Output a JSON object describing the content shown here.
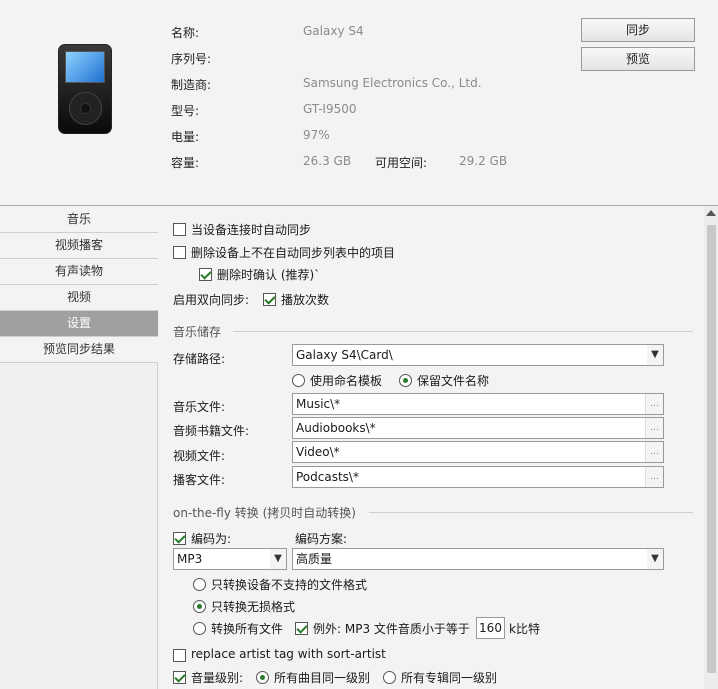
{
  "device": {
    "name_label": "名称:",
    "name_value": "Galaxy S4",
    "serial_label": "序列号:",
    "serial_value": "",
    "maker_label": "制造商:",
    "maker_value": "Samsung Electronics Co., Ltd.",
    "model_label": "型号:",
    "model_value": "GT-I9500",
    "battery_label": "电量:",
    "battery_value": "97%",
    "capacity_label": "容量:",
    "capacity_value": "26.3 GB",
    "free_label": "可用空间:",
    "free_value": "29.2 GB"
  },
  "buttons": {
    "sync": "同步",
    "preview": "预览"
  },
  "sidebar": {
    "items": [
      {
        "label": "音乐"
      },
      {
        "label": "视频播客"
      },
      {
        "label": "有声读物"
      },
      {
        "label": "视频"
      },
      {
        "label": "设置"
      },
      {
        "label": "预览同步结果"
      }
    ],
    "selected": "设置"
  },
  "settings": {
    "auto_sync": "当设备连接时自动同步",
    "delete_items": "删除设备上不在自动同步列表中的项目",
    "confirm_delete": "删除时确认 (推荐)`",
    "two_way_label": "启用双向同步:",
    "play_count": "播放次数",
    "music_storage_title": "音乐储存",
    "storage_path_label": "存储路径:",
    "storage_path_value": "Galaxy S4\\Card\\",
    "use_naming_template": "使用命名模板",
    "keep_filename": "保留文件名称",
    "music_file_label": "音乐文件:",
    "music_file_value": "Music\\*",
    "audiobook_label": "音频书籍文件:",
    "audiobook_value": "Audiobooks\\*",
    "video_label": "视频文件:",
    "video_value": "Video\\*",
    "podcast_label": "播客文件:",
    "podcast_value": "Podcasts\\*",
    "otf_title": "on-the-fly 转换 (拷贝时自动转换)",
    "encode_to_label": "编码为:",
    "encode_scheme_label": "编码方案:",
    "encode_format": "MP3",
    "encode_quality": "高质量",
    "opt_unsupported": "只转换设备不支持的文件格式",
    "opt_lossless": "只转换无损格式",
    "opt_all": "转换所有文件",
    "exception_label": "例外: MP3 文件音质小于等于",
    "bitrate": "160",
    "kbps": "k比特",
    "replace_artist": "replace artist tag with sort-artist",
    "volume_label": "音量级别:",
    "vol_track": "所有曲目同一级别",
    "vol_album": "所有专辑同一级别"
  }
}
